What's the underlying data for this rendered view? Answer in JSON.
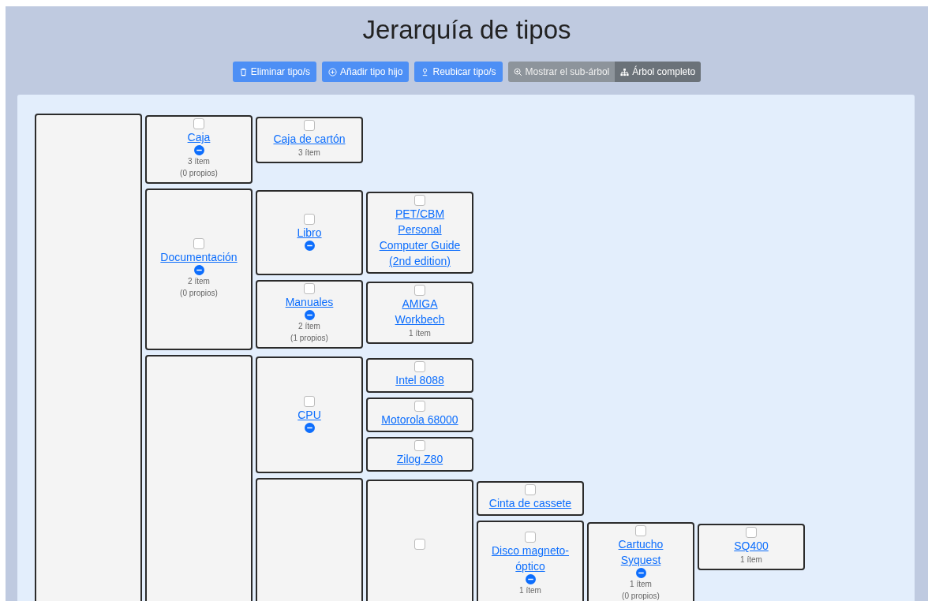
{
  "title": "Jerarquía de tipos",
  "actions": [
    {
      "label": "Eliminar tipo/s"
    },
    {
      "label": "Añadir tipo hijo"
    },
    {
      "label": "Reubicar tipo/s"
    }
  ],
  "views": [
    {
      "label": "Mostrar el sub-árbol",
      "selected": false
    },
    {
      "label": "Árbol completo",
      "selected": true
    }
  ],
  "tree": {
    "children": [
      {
        "label": "Caja",
        "checked": false,
        "collapsible": true,
        "count": "3 ítem",
        "own": "(0 propios)",
        "children": [
          {
            "label": "Caja de cartón",
            "checked": false,
            "collapsible": false,
            "count": "3 ítem"
          }
        ]
      },
      {
        "label": "Documentación",
        "checked": false,
        "collapsible": true,
        "count": "2 ítem",
        "own": "(0 propios)",
        "children": [
          {
            "label": "Libro",
            "checked": false,
            "collapsible": true,
            "children": [
              {
                "label": "PET/CBM Personal Computer Guide (2nd edition)",
                "checked": false,
                "collapsible": false
              }
            ]
          },
          {
            "label": "Manuales",
            "checked": false,
            "collapsible": true,
            "count": "2 ítem",
            "own": "(1 propios)",
            "children": [
              {
                "label": "AMIGA Workbech",
                "checked": false,
                "collapsible": false,
                "count": "1 ítem"
              }
            ]
          }
        ]
      },
      {
        "children": [
          {
            "label": "CPU",
            "checked": false,
            "collapsible": true,
            "children": [
              {
                "label": "Intel 8088",
                "checked": false,
                "collapsible": false
              },
              {
                "label": "Motorola 68000",
                "checked": false,
                "collapsible": false
              },
              {
                "label": "Zilog Z80",
                "checked": false,
                "collapsible": false
              }
            ]
          },
          {
            "children": [
              {
                "checked": false,
                "children": [
                  {
                    "label": "Cinta de cassete",
                    "checked": false,
                    "collapsible": false
                  },
                  {
                    "label": "Disco magneto-óptico",
                    "checked": false,
                    "collapsible": true,
                    "count": "1 ítem",
                    "children": [
                      {
                        "label": "Cartucho Syquest",
                        "checked": false,
                        "collapsible": true,
                        "count": "1 ítem",
                        "own": "(0 propios)",
                        "children": [
                          {
                            "label": "SQ400",
                            "checked": false,
                            "collapsible": false,
                            "count": "1 ítem"
                          }
                        ]
                      }
                    ]
                  }
                ]
              }
            ]
          }
        ]
      }
    ]
  }
}
